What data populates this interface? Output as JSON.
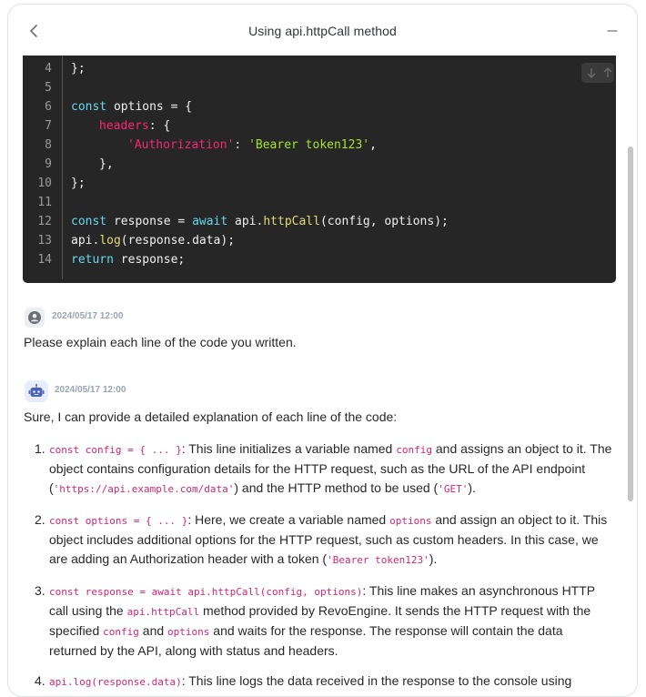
{
  "header": {
    "title": "Using api.httpCall method"
  },
  "code": {
    "lines": [
      {
        "n": "4"
      },
      {
        "n": "5"
      },
      {
        "n": "6"
      },
      {
        "n": "7"
      },
      {
        "n": "8"
      },
      {
        "n": "9"
      },
      {
        "n": "10"
      },
      {
        "n": "11"
      },
      {
        "n": "12"
      },
      {
        "n": "13"
      },
      {
        "n": "14"
      }
    ],
    "t": {
      "l4": "};",
      "l6a": "const",
      "l6b": " options = {",
      "l7a": "headers",
      "l7b": ": {",
      "l8a": "'Authorization'",
      "l8b": ": ",
      "l8c": "'Bearer token123'",
      "l8d": ",",
      "l9": "},",
      "l10": "};",
      "l12a": "const",
      "l12b": " response = ",
      "l12c": "await",
      "l12d": " api.",
      "l12e": "httpCall",
      "l12f": "(config, options);",
      "l13a": "api.",
      "l13b": "log",
      "l13c": "(response.data);",
      "l14a": "return",
      "l14b": " response;"
    }
  },
  "messages": {
    "user": {
      "timestamp": "2024/05/17 12:00",
      "text": "Please explain each line of the code you written."
    },
    "bot": {
      "timestamp": "2024/05/17 12:00",
      "intro": "Sure, I can provide a detailed explanation of each line of the code:",
      "items": [
        {
          "num": "1.",
          "c1": "const config = { ... }",
          "t1": ": This line initializes a variable named ",
          "c2": "config",
          "t2": " and assigns an object to it. The object contains configuration details for the HTTP request, such as the URL of the API endpoint (",
          "c3": "'https://api.example.com/data'",
          "t3": ") and the HTTP method to be used (",
          "c4": "'GET'",
          "t4": ")."
        },
        {
          "num": "2.",
          "c1": "const options = { ... }",
          "t1": ": Here, we create a variable named ",
          "c2": "options",
          "t2": " and assign an object to it. This object includes additional options for the HTTP request, such as custom headers. In this case, we are adding an Authorization header with a token (",
          "c3": "'Bearer token123'",
          "t3": ")."
        },
        {
          "num": "3.",
          "c1": "const response = await api.httpCall(config, options)",
          "t1": ": This line makes an asynchronous HTTP call using the ",
          "c2": "api.httpCall",
          "t2": " method provided by RevoEngine. It sends the HTTP request with the specified ",
          "c3": "config",
          "t3": " and ",
          "c4": "options",
          "t4": " and waits for the response. The response will contain the data returned by the API, along with status and headers."
        },
        {
          "num": "4.",
          "c1": "api.log(response.data)",
          "t1": ": This line logs the data received in the response to the console using"
        }
      ]
    }
  }
}
